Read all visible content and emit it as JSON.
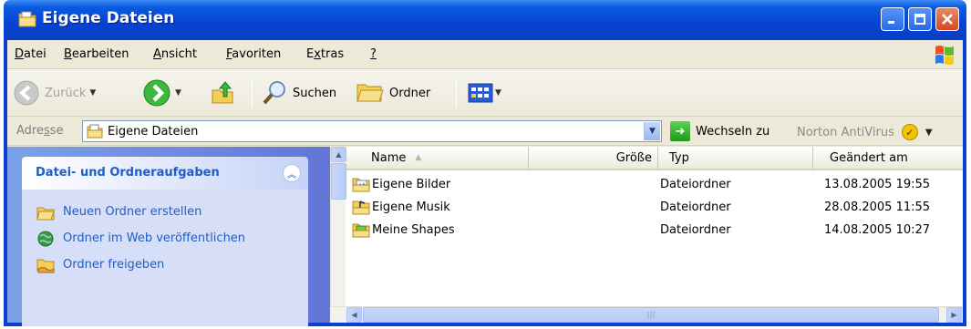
{
  "window": {
    "title": "Eigene Dateien"
  },
  "menu": {
    "items": [
      {
        "pre": "",
        "key": "D",
        "post": "atei"
      },
      {
        "pre": "",
        "key": "B",
        "post": "earbeiten"
      },
      {
        "pre": "",
        "key": "A",
        "post": "nsicht"
      },
      {
        "pre": "",
        "key": "F",
        "post": "avoriten"
      },
      {
        "pre": "E",
        "key": "x",
        "post": "tras"
      },
      {
        "pre": "",
        "key": "?",
        "post": ""
      }
    ]
  },
  "toolbar": {
    "back_label": "Zurück",
    "search_label": "Suchen",
    "folders_label": "Ordner"
  },
  "address": {
    "label_pre": "Adre",
    "label_key": "s",
    "label_post": "se",
    "value": "Eigene Dateien",
    "go_label": "Wechseln zu",
    "norton_label": "Norton AntiVirus"
  },
  "tasks": {
    "title": "Datei- und Ordneraufgaben",
    "links": [
      {
        "label": "Neuen Ordner erstellen",
        "icon": "new-folder-icon"
      },
      {
        "label": "Ordner im Web veröffentlichen",
        "icon": "publish-web-icon"
      },
      {
        "label": "Ordner freigeben",
        "icon": "share-folder-icon"
      }
    ]
  },
  "list": {
    "columns": {
      "name": "Name",
      "size": "Größe",
      "type": "Typ",
      "modified": "Geändert am"
    },
    "rows": [
      {
        "name": "Eigene Bilder",
        "size": "",
        "type": "Dateiordner",
        "modified": "13.08.2005 19:55",
        "icon": "pictures-folder-icon"
      },
      {
        "name": "Eigene Musik",
        "size": "",
        "type": "Dateiordner",
        "modified": "28.08.2005 11:55",
        "icon": "music-folder-icon"
      },
      {
        "name": "Meine Shapes",
        "size": "",
        "type": "Dateiordner",
        "modified": "14.08.2005 10:27",
        "icon": "shapes-folder-icon"
      }
    ]
  },
  "colors": {
    "titlebar": "#0a3fd4",
    "chrome": "#ece9d8",
    "task_pane": "#6375d6",
    "task_link": "#215dc6"
  }
}
